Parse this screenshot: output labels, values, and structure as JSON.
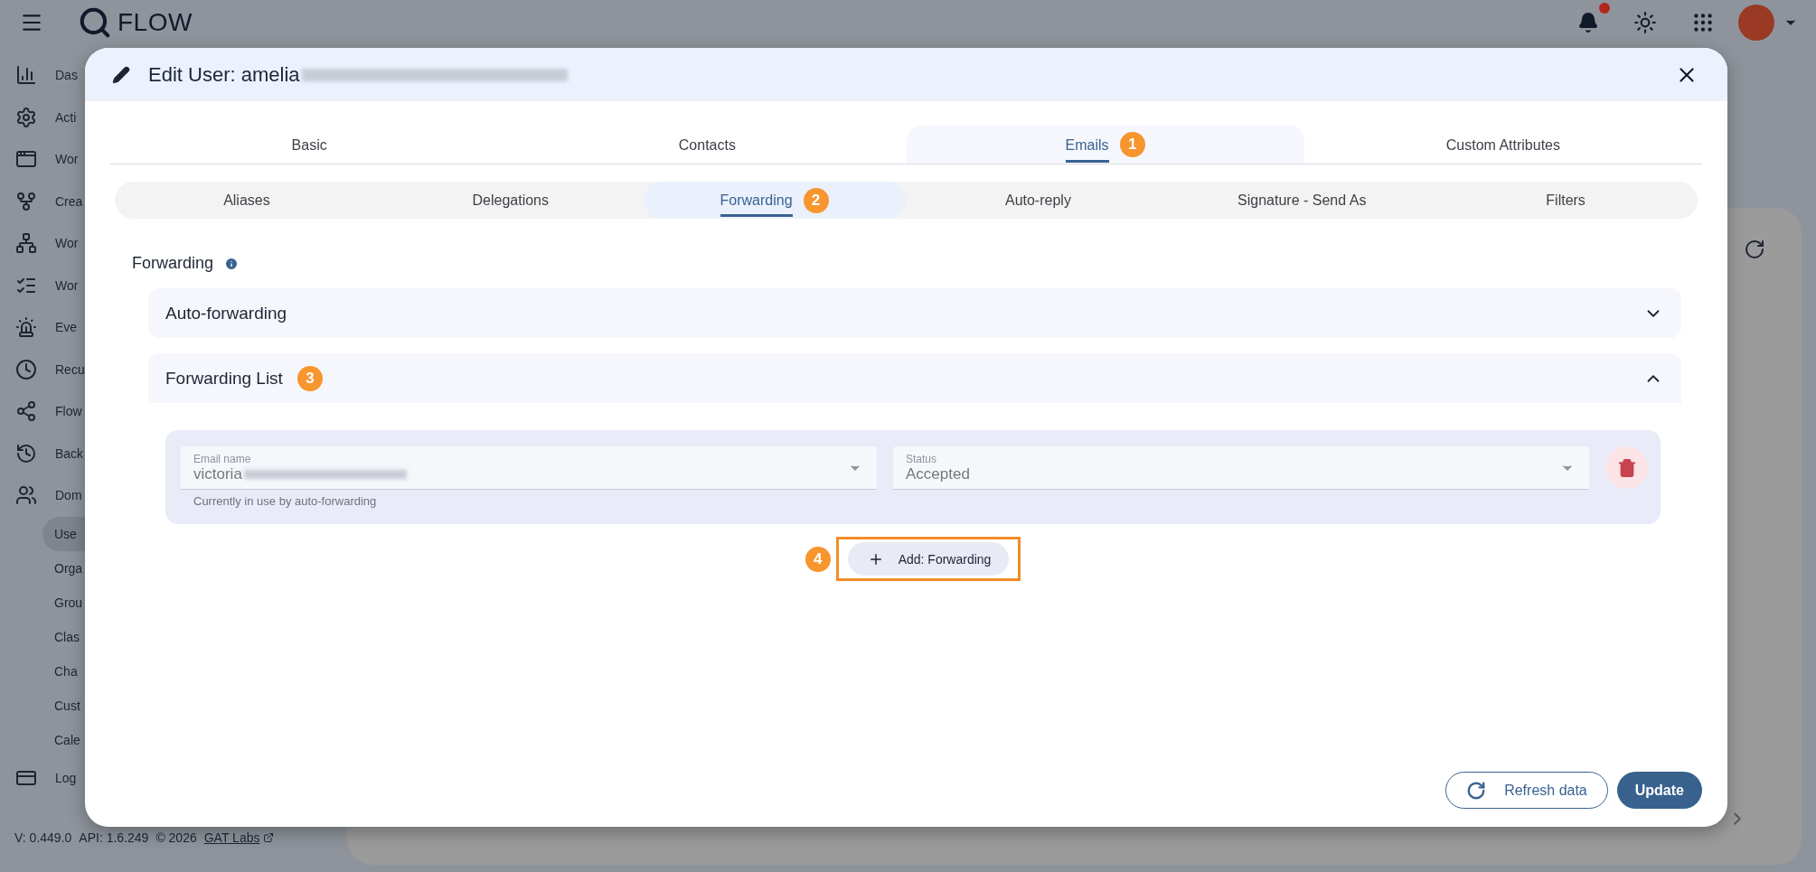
{
  "topbar": {
    "logo_text": "FLOW",
    "notification_dot": true
  },
  "sidebar": {
    "items": [
      {
        "label": "Das",
        "selected": false
      },
      {
        "label": "Acti",
        "selected": false
      },
      {
        "label": "Wor",
        "selected": false
      },
      {
        "label": "Crea",
        "selected": false
      },
      {
        "label": "Wor",
        "selected": false
      },
      {
        "label": "Wor",
        "selected": false
      },
      {
        "label": "Eve",
        "selected": false
      },
      {
        "label": "Recu",
        "selected": false
      },
      {
        "label": "Flow",
        "selected": false
      },
      {
        "label": "Back",
        "selected": false
      },
      {
        "label": "Dom",
        "selected": false,
        "children": [
          {
            "label": "Use",
            "selected": true
          },
          {
            "label": "Orga",
            "selected": false
          },
          {
            "label": "Grou",
            "selected": false
          },
          {
            "label": "Clas",
            "selected": false
          },
          {
            "label": "Cha",
            "selected": false
          },
          {
            "label": "Cust",
            "selected": false
          },
          {
            "label": "Cale",
            "selected": false
          }
        ]
      },
      {
        "label": "Log",
        "selected": false
      }
    ]
  },
  "footer": {
    "version": "V: 0.449.0",
    "api": "API: 1.6.249",
    "copyright": "© 2026",
    "link": "GAT Labs"
  },
  "dialog": {
    "title": "Edit User: amelia",
    "tabs": [
      {
        "label": "Basic",
        "selected": false
      },
      {
        "label": "Contacts",
        "selected": false
      },
      {
        "label": "Emails",
        "selected": true,
        "badge": "1"
      },
      {
        "label": "Custom Attributes",
        "selected": false
      }
    ],
    "subtabs": [
      {
        "label": "Aliases",
        "selected": false
      },
      {
        "label": "Delegations",
        "selected": false
      },
      {
        "label": "Forwarding",
        "selected": true,
        "badge": "2"
      },
      {
        "label": "Auto-reply",
        "selected": false
      },
      {
        "label": "Signature - Send As",
        "selected": false
      },
      {
        "label": "Filters",
        "selected": false
      }
    ],
    "section_title": "Forwarding",
    "accordions": [
      {
        "title": "Auto-forwarding",
        "expanded": false
      },
      {
        "title": "Forwarding List",
        "expanded": true,
        "badge": "3"
      }
    ],
    "entries": [
      {
        "email_label": "Email name",
        "email_value": "victoria",
        "helper": "Currently in use by auto-forwarding",
        "status_label": "Status",
        "status_value": "Accepted"
      }
    ],
    "add_button": {
      "label": "Add: Forwarding",
      "badge": "4",
      "highlighted": true
    },
    "buttons": [
      {
        "label": "Refresh data",
        "kind": "outlined"
      },
      {
        "label": "Update",
        "kind": "filled"
      }
    ]
  }
}
